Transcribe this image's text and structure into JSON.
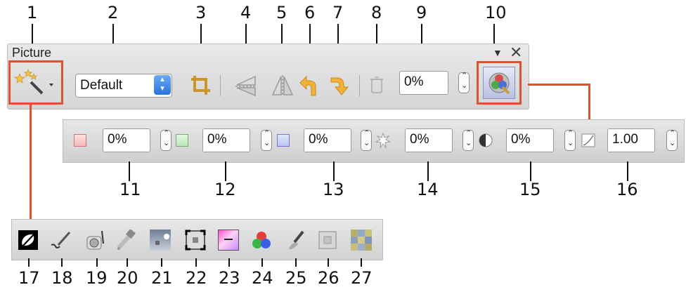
{
  "callouts": [
    "1",
    "2",
    "3",
    "4",
    "5",
    "6",
    "7",
    "8",
    "9",
    "10",
    "11",
    "12",
    "13",
    "14",
    "15",
    "16",
    "17",
    "18",
    "19",
    "20",
    "21",
    "22",
    "23",
    "24",
    "25",
    "26",
    "27"
  ],
  "picture_toolbar": {
    "title": "Picture",
    "menu_glyph": "▼",
    "close_glyph": "✕",
    "mode_select": "Default",
    "transparency": "0%"
  },
  "color_toolbar": {
    "red": "0%",
    "green": "0%",
    "blue": "0%",
    "brightness": "0%",
    "contrast": "0%",
    "gamma": "1.00"
  },
  "colors": {
    "callout_line": "#e0522f"
  }
}
